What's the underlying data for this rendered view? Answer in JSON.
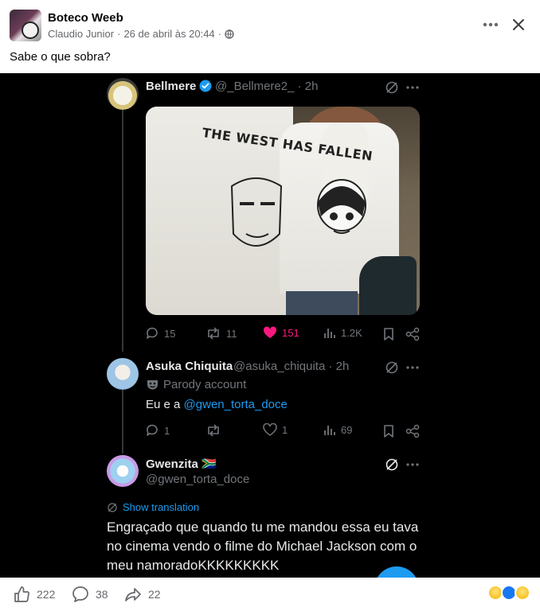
{
  "fb_post": {
    "page_name": "Boteco Weeb",
    "author": "Claudio Junior",
    "separator": "·",
    "date": "26 de abril às 20:44",
    "privacy_icon": "globe-icon",
    "caption": "Sabe o que sobra?",
    "more_icon": "more-horizontal-icon",
    "close_icon": "close-icon"
  },
  "embedded_thread": {
    "tweets": [
      {
        "name": "Bellmere",
        "verified": true,
        "handle": "@_Bellmere2_",
        "time": "· 2h",
        "photo_shirt_text": "THE WEST HAS FALLEN",
        "actions": {
          "replies": "15",
          "reposts": "11",
          "likes": "151",
          "views": "1.2K"
        }
      },
      {
        "name": "Asuka Chiquita",
        "handle": "@asuka_chiquita",
        "time": "· 2h",
        "parody_label": "Parody account",
        "text_prefix": "Eu e a ",
        "mention": "@gwen_torta_doce",
        "actions": {
          "replies": "1",
          "likes": "1",
          "views": "69"
        }
      },
      {
        "name": "Gwenzita",
        "flag": "🇿🇦",
        "handle": "@gwen_torta_doce",
        "translate_label": "Show translation",
        "text_lines": [
          "Engraçado que quando tu me mandou essa eu tava",
          "no cinema vendo o filme do Michael Jackson com o",
          "meu namoradoKKKKKKKKK"
        ]
      }
    ],
    "colors": {
      "background": "#000000",
      "text": "#e7e9ea",
      "muted": "#71767b",
      "link": "#1d9bf0",
      "like": "#f91880"
    }
  },
  "fb_footer": {
    "likes": "222",
    "comments": "38",
    "shares": "22",
    "reactions": [
      "haha",
      "like",
      "sad"
    ]
  }
}
